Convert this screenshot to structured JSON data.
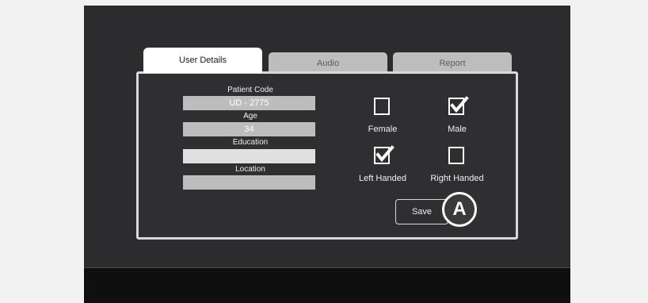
{
  "tabs": [
    {
      "label": "User Details",
      "active": true
    },
    {
      "label": "Audio",
      "active": false
    },
    {
      "label": "Report",
      "active": false
    }
  ],
  "fields": {
    "patient_code": {
      "label": "Patient Code",
      "value": "UD - 2775"
    },
    "age": {
      "label": "Age",
      "value": "34"
    },
    "education": {
      "label": "Education",
      "value": ""
    },
    "location": {
      "label": "Location",
      "value": ""
    }
  },
  "options": {
    "female": {
      "label": "Female",
      "checked": false
    },
    "male": {
      "label": "Male",
      "checked": true
    },
    "left_handed": {
      "label": "Left Handed",
      "checked": true
    },
    "right_handed": {
      "label": "Right Handed",
      "checked": false
    }
  },
  "save_label": "Save",
  "callout_label": "A",
  "colors": {
    "device_bg": "#2c2c2e",
    "panel_border": "#d9d9d9",
    "input_bg": "#bdbdbd",
    "tab_inactive": "#bdbdbd"
  },
  "icons": {
    "checked": "checkbox-checked-icon",
    "unchecked": "checkbox-unchecked-icon"
  }
}
